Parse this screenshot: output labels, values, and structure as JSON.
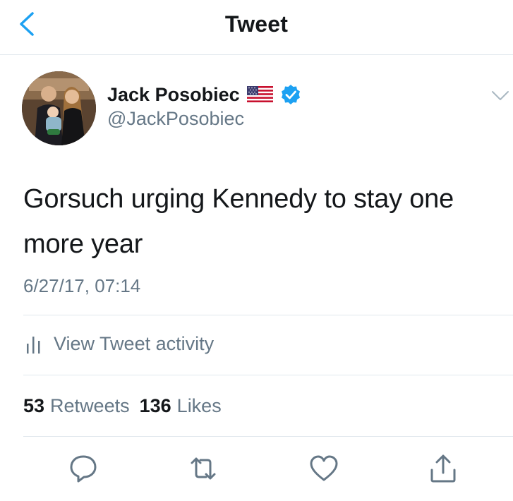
{
  "header": {
    "title": "Tweet",
    "back_icon": "chevron-left-icon"
  },
  "author": {
    "name": "Jack Posobiec",
    "handle": "@JackPosobiec",
    "flag_icon": "us-flag-icon",
    "verified_icon": "verified-badge-icon",
    "menu_icon": "chevron-down-icon"
  },
  "tweet": {
    "text": "Gorsuch urging Kennedy to stay one more year",
    "timestamp": "6/27/17, 07:14"
  },
  "activity": {
    "label": "View Tweet activity",
    "icon": "bar-chart-icon"
  },
  "stats": {
    "retweets_count": "53",
    "retweets_label": "Retweets",
    "likes_count": "136",
    "likes_label": "Likes"
  },
  "actions": [
    {
      "name": "reply",
      "icon": "reply-icon"
    },
    {
      "name": "retweet",
      "icon": "retweet-icon"
    },
    {
      "name": "like",
      "icon": "heart-icon"
    },
    {
      "name": "share",
      "icon": "share-icon"
    }
  ],
  "colors": {
    "accent": "#1da1f2",
    "text": "#14171a",
    "secondary": "#657786",
    "divider": "#e1e8ed"
  }
}
